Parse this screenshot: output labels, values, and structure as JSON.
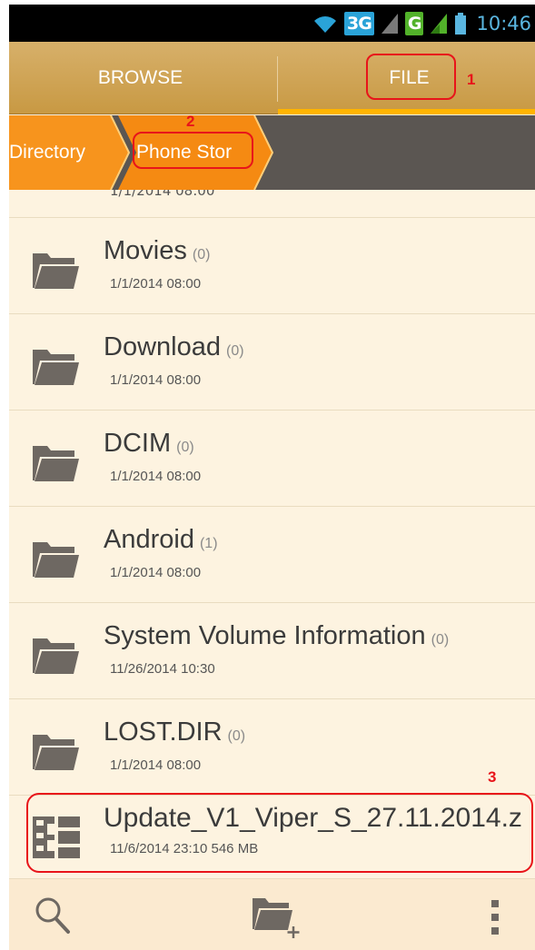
{
  "status_bar": {
    "network_3g": "3G",
    "network_g": "G",
    "time": "10:46"
  },
  "tabs": {
    "browse_label": "BROWSE",
    "file_label": "FILE",
    "active": "FILE"
  },
  "breadcrumb": {
    "items": [
      "Directory",
      "Phone Stor"
    ]
  },
  "file_list": {
    "partial_top_date": "1/1/2014 08:00",
    "items": [
      {
        "name": "Movies",
        "count": "(0)",
        "date": "1/1/2014 08:00",
        "type": "folder"
      },
      {
        "name": "Download",
        "count": "(0)",
        "date": "1/1/2014 08:00",
        "type": "folder"
      },
      {
        "name": "DCIM",
        "count": "(0)",
        "date": "1/1/2014 08:00",
        "type": "folder"
      },
      {
        "name": "Android",
        "count": "(1)",
        "date": "1/1/2014 08:00",
        "type": "folder"
      },
      {
        "name": "System Volume Information",
        "count": "(0)",
        "date": "11/26/2014 10:30",
        "type": "folder"
      },
      {
        "name": "LOST.DIR",
        "count": "(0)",
        "date": "1/1/2014 08:00",
        "type": "folder"
      },
      {
        "name": "Update_V1_Viper_S_27.11.2014.z",
        "count": "",
        "date": "11/6/2014 23:10",
        "size": "546 MB",
        "type": "archive"
      }
    ]
  },
  "toolbar": {
    "icons": [
      "search-icon",
      "new-folder-icon",
      "overflow-menu-icon"
    ]
  },
  "annotations": {
    "labels": [
      "1",
      "2",
      "3"
    ],
    "color": "#e8141a"
  },
  "colors": {
    "tab_bar": "#c89943",
    "tab_underline": "#ffb400",
    "breadcrumb_orange": "#f7941d",
    "breadcrumb_bg": "#5b5652",
    "list_bg": "#fdf3e0",
    "folder_icon": "#6e6862"
  }
}
